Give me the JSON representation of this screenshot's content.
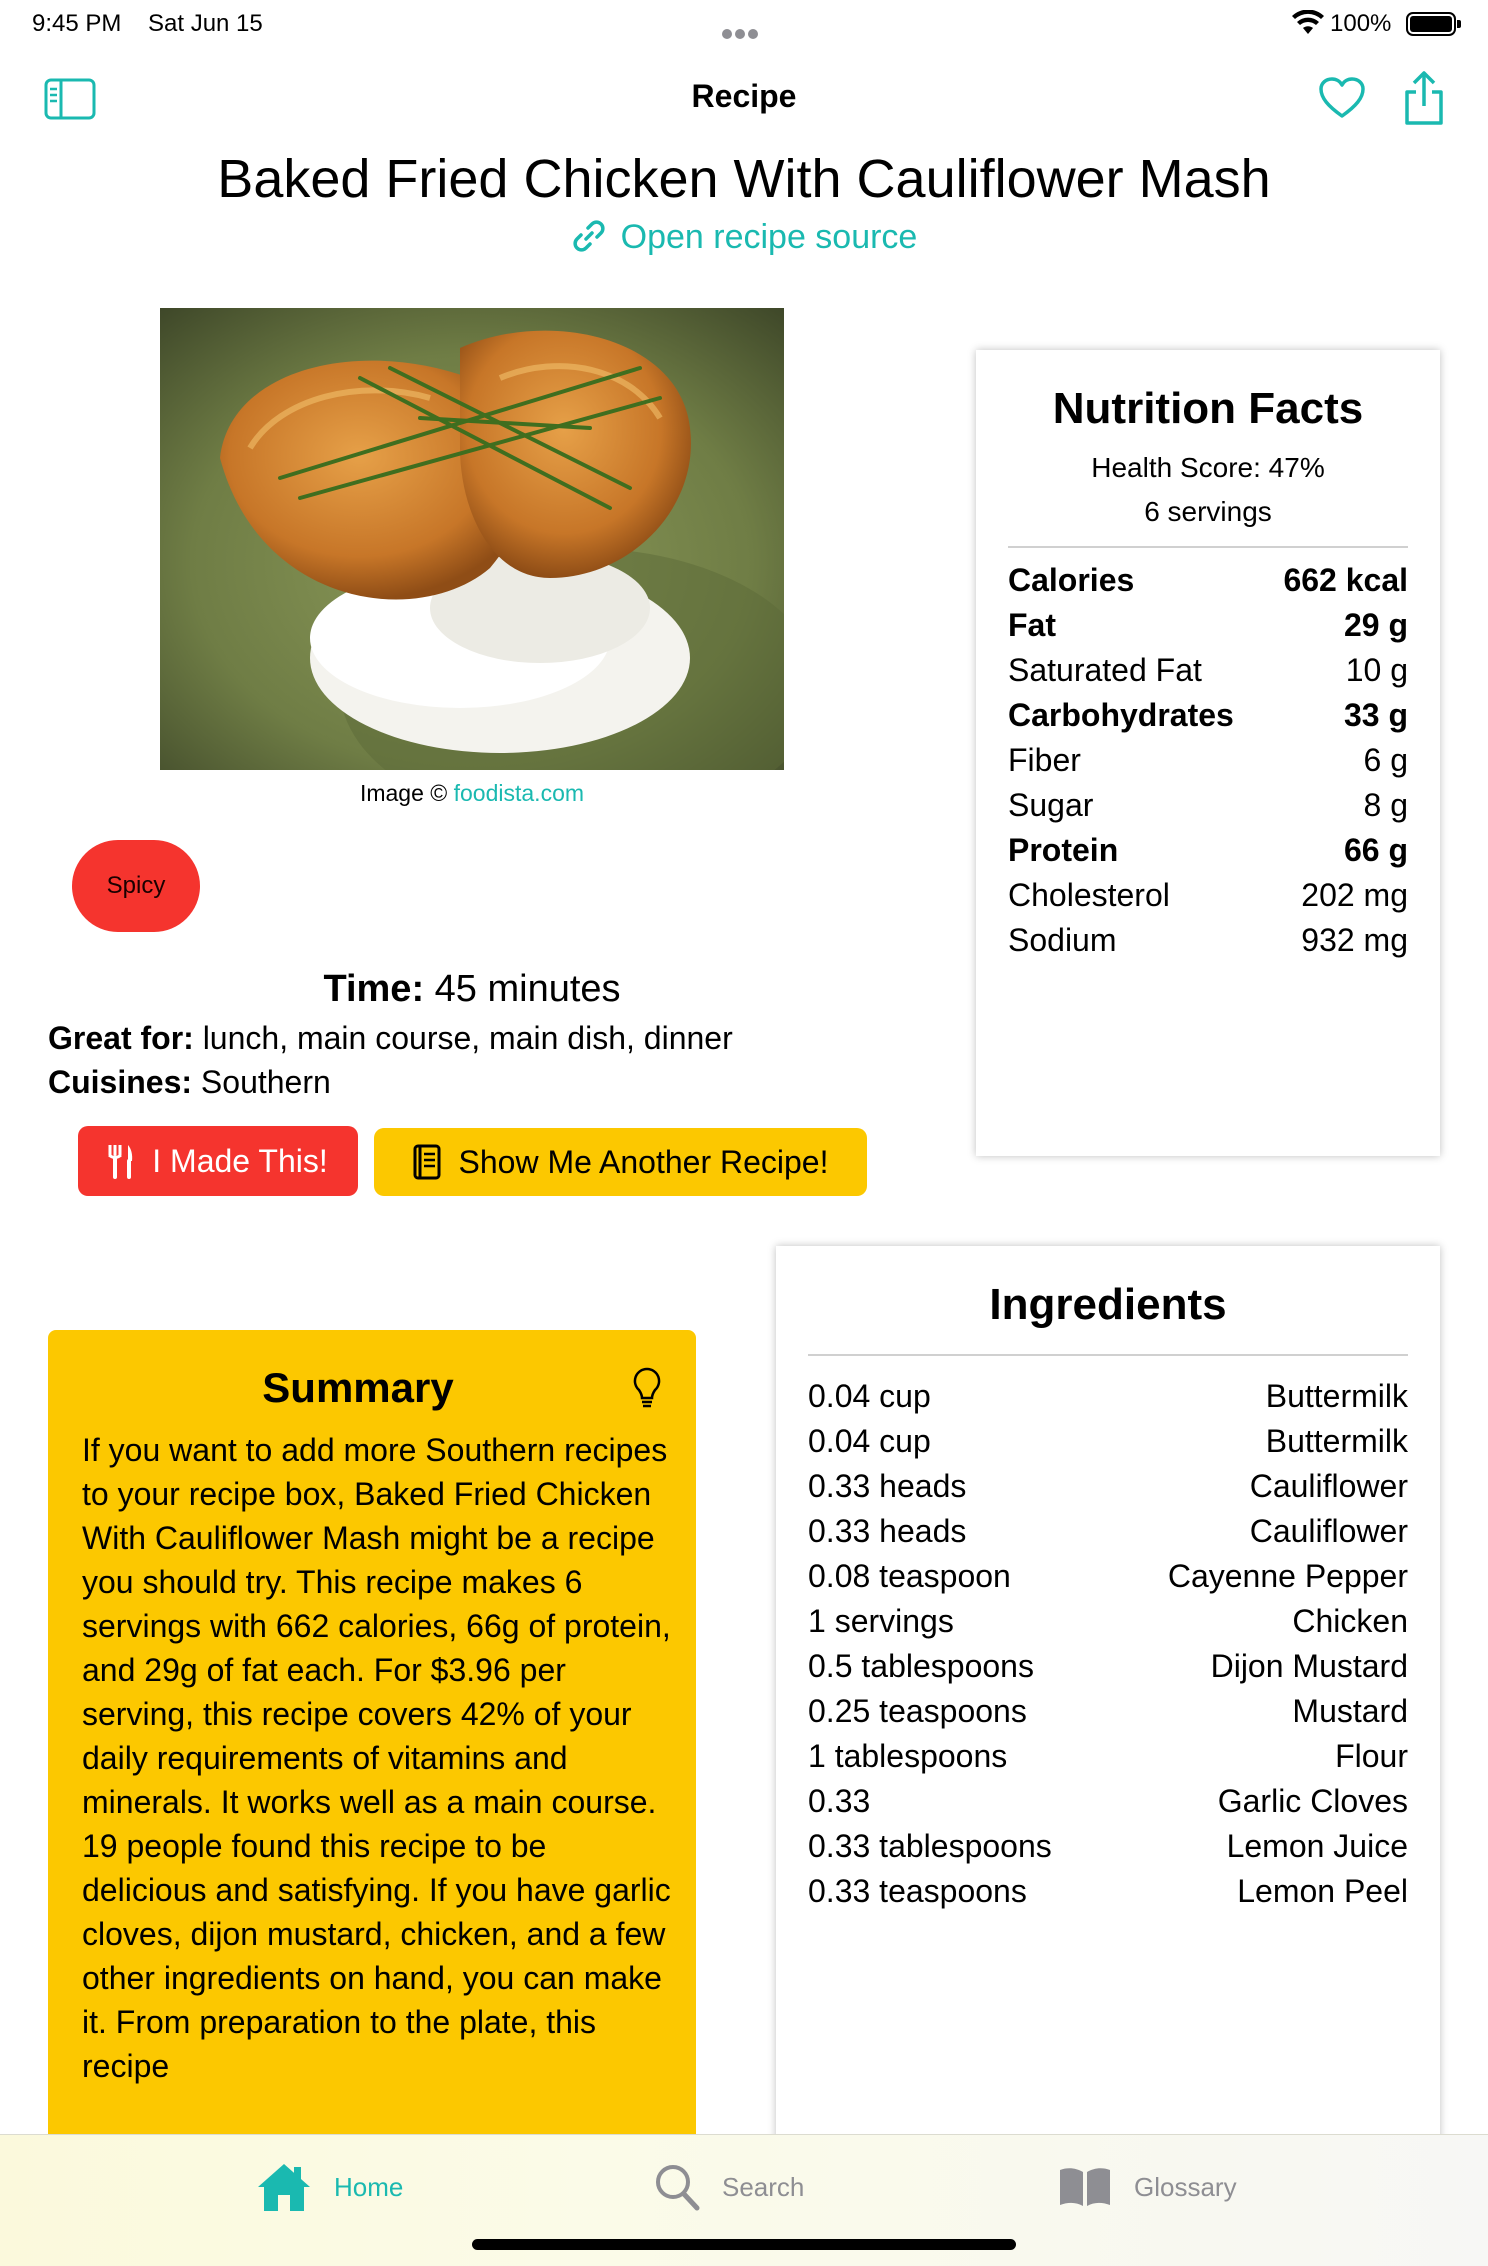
{
  "status_bar": {
    "time": "9:45 PM",
    "date": "Sat Jun 15",
    "battery": "100%"
  },
  "nav": {
    "title": "Recipe",
    "left_icon": "sidebar-icon",
    "right_icons": [
      "heart-icon",
      "share-icon"
    ]
  },
  "recipe": {
    "title": "Baked Fried Chicken With Cauliflower Mash",
    "source_link": "Open recipe source",
    "image_credit_prefix": "Image ©",
    "image_credit_link": "foodista.com",
    "tag": "Spicy",
    "time_label": "Time:",
    "time_value": "45 minutes",
    "great_for_label": "Great for:",
    "great_for_value": "lunch, main course, main dish, dinner",
    "cuisines_label": "Cuisines:",
    "cuisines_value": "Southern",
    "made_button": "I Made This!",
    "another_button": "Show Me Another Recipe!"
  },
  "nutrition": {
    "title": "Nutrition Facts",
    "health_score": "Health Score: 47%",
    "servings": "6 servings",
    "rows": [
      {
        "name": "Calories",
        "value": "662 kcal",
        "bold": true
      },
      {
        "name": "Fat",
        "value": "29 g",
        "bold": true
      },
      {
        "name": "Saturated Fat",
        "value": "10 g",
        "bold": false
      },
      {
        "name": "Carbohydrates",
        "value": "33 g",
        "bold": true
      },
      {
        "name": "Fiber",
        "value": "6 g",
        "bold": false
      },
      {
        "name": "Sugar",
        "value": "8 g",
        "bold": false
      },
      {
        "name": "Protein",
        "value": "66 g",
        "bold": true
      },
      {
        "name": "Cholesterol",
        "value": "202 mg",
        "bold": false
      },
      {
        "name": "Sodium",
        "value": "932 mg",
        "bold": false
      }
    ]
  },
  "summary": {
    "title": "Summary",
    "text": "If you want to add more Southern recipes to your recipe box, Baked Fried Chicken With Cauliflower Mash might be a recipe you should try. This recipe makes 6 servings with 662 calories, 66g of protein, and 29g of fat each. For $3.96 per serving, this recipe covers 42% of your daily requirements of vitamins and minerals. It works well as a main course. 19 people found this recipe to be delicious and satisfying. If you have garlic cloves, dijon mustard, chicken, and a few other ingredients on hand, you can make it. From preparation to the plate, this recipe"
  },
  "ingredients": {
    "title": "Ingredients",
    "rows": [
      {
        "amount": "0.04 cup",
        "name": "Buttermilk"
      },
      {
        "amount": "0.04 cup",
        "name": "Buttermilk"
      },
      {
        "amount": "0.33 heads",
        "name": "Cauliflower"
      },
      {
        "amount": "0.33 heads",
        "name": "Cauliflower"
      },
      {
        "amount": "0.08 teaspoon",
        "name": "Cayenne Pepper"
      },
      {
        "amount": "1 servings",
        "name": "Chicken"
      },
      {
        "amount": "0.5 tablespoons",
        "name": "Dijon Mustard"
      },
      {
        "amount": "0.25 teaspoons",
        "name": "Mustard"
      },
      {
        "amount": "1 tablespoons",
        "name": "Flour"
      },
      {
        "amount": "0.33",
        "name": "Garlic Cloves"
      },
      {
        "amount": "0.33 tablespoons",
        "name": "Lemon Juice"
      },
      {
        "amount": "0.33 teaspoons",
        "name": "Lemon Peel"
      }
    ]
  },
  "tab_bar": {
    "items": [
      {
        "label": "Home",
        "icon": "house-icon",
        "active": true
      },
      {
        "label": "Search",
        "icon": "magnifier-icon",
        "active": false
      },
      {
        "label": "Glossary",
        "icon": "book-icon",
        "active": false
      }
    ]
  },
  "colors": {
    "accent": "#1ab9b0",
    "red": "#f5342e",
    "yellow": "#fcc800"
  }
}
